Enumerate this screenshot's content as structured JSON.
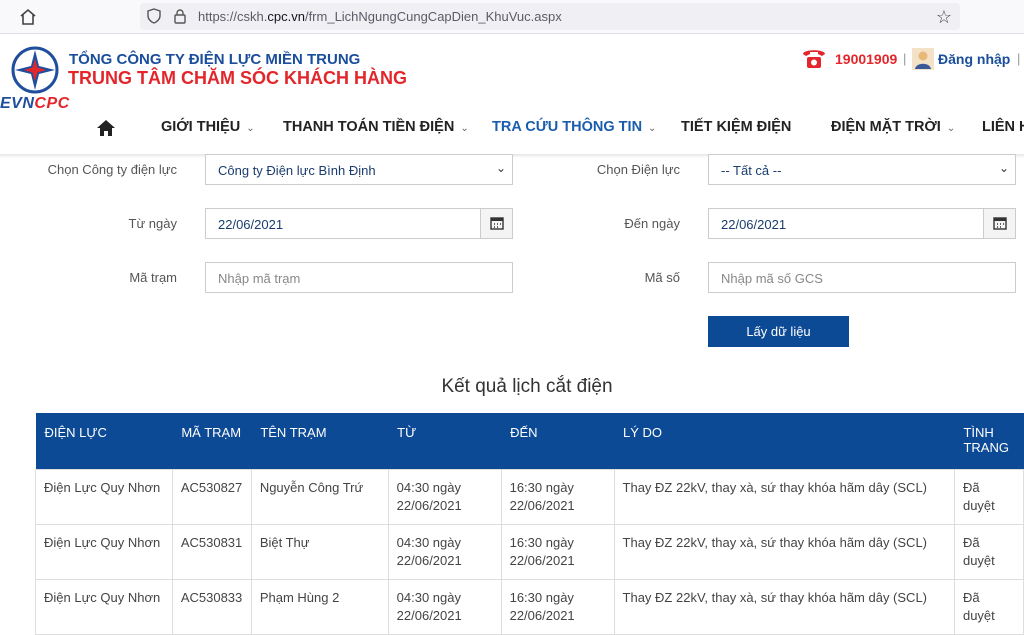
{
  "browser": {
    "url_prefix": "https://cskh.",
    "url_domain": "cpc.vn",
    "url_path": "/frm_LichNgungCungCapDien_KhuVuc.aspx"
  },
  "header": {
    "logo_text_evn": "EVN",
    "logo_text_cpc": "CPC",
    "company": "TỔNG CÔNG TY ĐIỆN LỰC MIỀN TRUNG",
    "center": "TRUNG TÂM CHĂM SÓC KHÁCH HÀNG",
    "hotline": "19001909",
    "separator": "|",
    "login": "Đăng nhập"
  },
  "nav": {
    "items": [
      {
        "label": "GIỚI THIỆU"
      },
      {
        "label": "THANH TOÁN TIỀN ĐIỆN"
      },
      {
        "label": "TRA CỨU THÔNG TIN"
      },
      {
        "label": "TIẾT KIỆM ĐIỆN"
      },
      {
        "label": "ĐIỆN MẶT TRỜI"
      },
      {
        "label": "LIÊN H"
      }
    ]
  },
  "form": {
    "company_label": "Chọn Công ty điện lực",
    "company_value": "Công ty Điện lực Bình Định",
    "unit_label": "Chọn Điện lực",
    "unit_value": "-- Tất cả --",
    "from_label": "Từ ngày",
    "from_value": "22/06/2021",
    "to_label": "Đến ngày",
    "to_value": "22/06/2021",
    "station_label": "Mã trạm",
    "station_placeholder": "Nhập mã trạm",
    "code_label": "Mã số",
    "code_placeholder": "Nhập mã số GCS",
    "fetch_button": "Lấy dữ liệu"
  },
  "results": {
    "title": "Kết quả lịch cắt điện",
    "columns": [
      "ĐIỆN LỰC",
      "MÃ TRẠM",
      "TÊN TRẠM",
      "TỪ",
      "ĐẾN",
      "LÝ DO",
      "TÌNH TRANG"
    ],
    "rows": [
      {
        "unit": "Điện Lực Quy Nhơn",
        "code": "AC530827",
        "name": "Nguyễn Công Trứ",
        "from_time": "04:30 ngày",
        "from_date": "22/06/2021",
        "to_time": "16:30 ngày",
        "to_date": "22/06/2021",
        "reason": "Thay ĐZ 22kV, thay xà, sứ thay khóa hãm dây (SCL)",
        "status_1": "Đã",
        "status_2": "duyệt"
      },
      {
        "unit": "Điện Lực Quy Nhơn",
        "code": "AC530831",
        "name": "Biệt Thự",
        "from_time": "04:30 ngày",
        "from_date": "22/06/2021",
        "to_time": "16:30 ngày",
        "to_date": "22/06/2021",
        "reason": "Thay ĐZ 22kV, thay xà, sứ thay khóa hãm dây (SCL)",
        "status_1": "Đã",
        "status_2": "duyệt"
      },
      {
        "unit": "Điện Lực Quy Nhơn",
        "code": "AC530833",
        "name": "Phạm Hùng 2",
        "from_time": "04:30 ngày",
        "from_date": "22/06/2021",
        "to_time": "16:30 ngày",
        "to_date": "22/06/2021",
        "reason": "Thay ĐZ 22kV, thay xà, sứ thay khóa hãm dây (SCL)",
        "status_1": "Đã",
        "status_2": "duyệt"
      }
    ]
  },
  "colors": {
    "brand_blue": "#0d4a96",
    "brand_red": "#e3262b",
    "active_nav": "#1a5dad"
  }
}
